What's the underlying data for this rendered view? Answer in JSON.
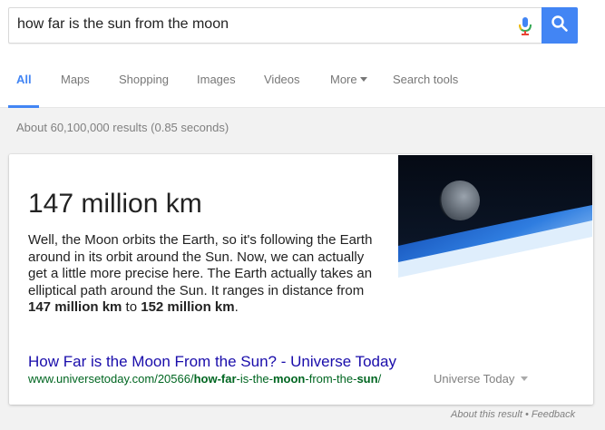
{
  "search": {
    "query": "how far is the sun from the moon"
  },
  "tabs": [
    {
      "label": "All",
      "active": true
    },
    {
      "label": "Maps"
    },
    {
      "label": "Shopping"
    },
    {
      "label": "Images"
    },
    {
      "label": "Videos"
    },
    {
      "label": "More"
    },
    {
      "label": "Search tools"
    }
  ],
  "result_stats": "About 60,100,000 results (0.85 seconds)",
  "answer": {
    "title": "147 million km",
    "snippet_parts": [
      "Well, the Moon orbits the Earth, so it's following the Earth around in its orbit around the Sun. Now, we can actually get a little more precise here. The Earth actually takes an elliptical path around the Sun. It ranges in distance from ",
      "147 million km",
      " to ",
      "152 million km",
      "."
    ],
    "link_title": "How Far is the Moon From the Sun? - Universe Today",
    "url_parts": [
      "www.universetoday.com/20566/",
      "how-far",
      "-is-the-",
      "moon",
      "-from-the-",
      "sun",
      "/"
    ],
    "source_name": "Universe Today"
  },
  "footer": {
    "about_label": "About this result",
    "separator": "•",
    "feedback_label": "Feedback"
  },
  "colors": {
    "accent": "#4285f4",
    "link": "#1a0dab",
    "url": "#006621",
    "muted": "#808080"
  },
  "icons": {
    "mic": "microphone-icon",
    "search": "search-icon"
  }
}
